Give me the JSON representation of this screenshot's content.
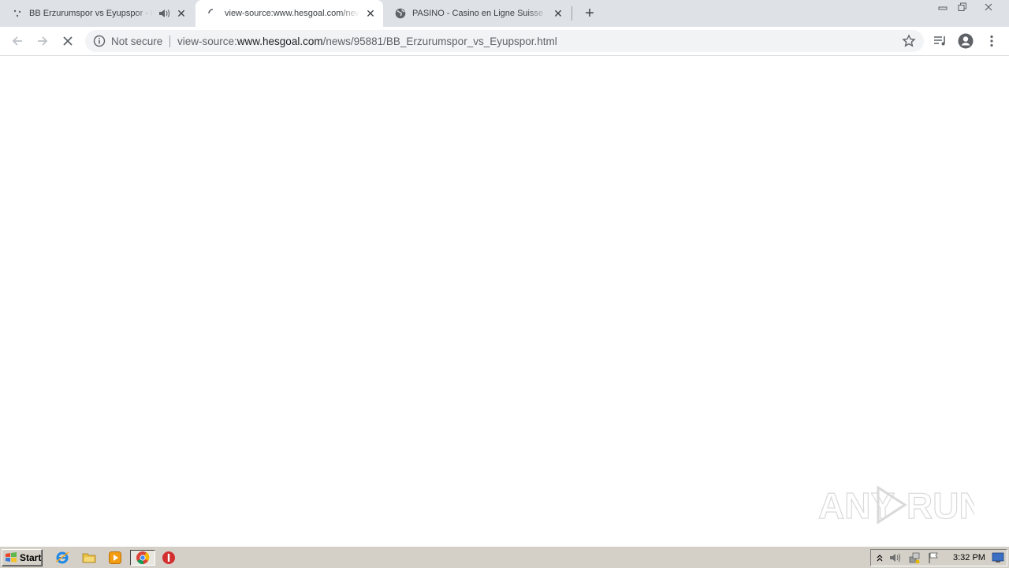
{
  "browser": {
    "tabs": [
      {
        "title": "BB Erzurumspor vs Eyupspor - H",
        "favicon": "soccer-ball-icon",
        "audio": true,
        "active": false
      },
      {
        "title": "view-source:www.hesgoal.com/new",
        "favicon": "loading-spinner-icon",
        "audio": false,
        "active": true
      },
      {
        "title": "PASINO - Casino en Ligne Suisse - S",
        "favicon": "globe-icon",
        "audio": false,
        "active": false
      }
    ],
    "new_tab_label": "+",
    "omnibox": {
      "security_label": "Not secure",
      "url_prefix": "view-source:",
      "url_host": "www.hesgoal.com",
      "url_path": "/news/95881/BB_Erzurumspor_vs_Eyupspor.html"
    }
  },
  "watermark": {
    "text": "ANY RUN"
  },
  "taskbar": {
    "start_label": "Start",
    "quick_launch": [
      "internet-explorer-icon",
      "folder-icon",
      "media-player-icon",
      "chrome-icon",
      "stop-icon"
    ],
    "clock": "3:32 PM"
  },
  "colors": {
    "tabstrip": "#dee1e6",
    "omnibox": "#f1f3f4",
    "taskbar": "#d4d0c8"
  }
}
